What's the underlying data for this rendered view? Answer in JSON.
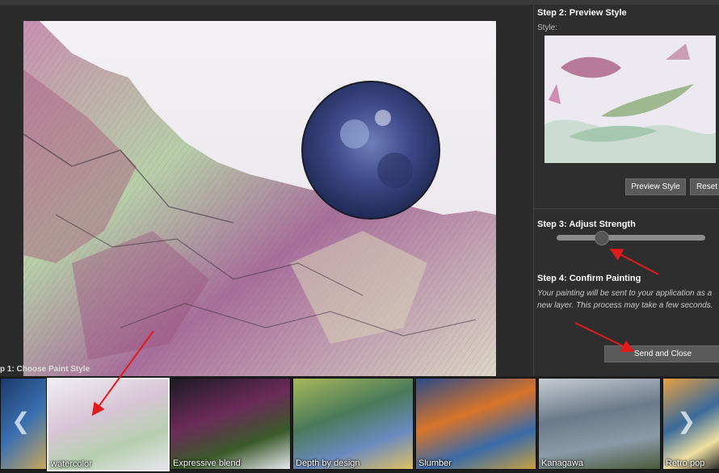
{
  "panel": {
    "step2_title": "Step 2: Preview Style",
    "style_label": "Style:",
    "preview_button": "Preview Style",
    "reset_button": "Reset",
    "step3_title": "Step 3: Adjust Strength",
    "strength": 0.3,
    "step4_title": "Step 4: Confirm Painting",
    "step4_desc": "Your painting will be sent to your application as a new layer. This process may take a few seconds.",
    "send_button": "Send and Close"
  },
  "strip": {
    "label": "p 1: Choose Paint Style",
    "styles": [
      {
        "label": ""
      },
      {
        "label": "watercolor"
      },
      {
        "label": "Expressive blend"
      },
      {
        "label": "Depth by design"
      },
      {
        "label": "Slumber"
      },
      {
        "label": "Kanagawa"
      },
      {
        "label": "Retro pop"
      }
    ]
  },
  "colors": {
    "annotation_arrow": "#e11b1b",
    "panel_bg": "#2e2e2e",
    "strip_bg": "#1f1f1f"
  },
  "icons": {
    "prev": "chevron-left-icon",
    "next": "chevron-right-icon"
  }
}
